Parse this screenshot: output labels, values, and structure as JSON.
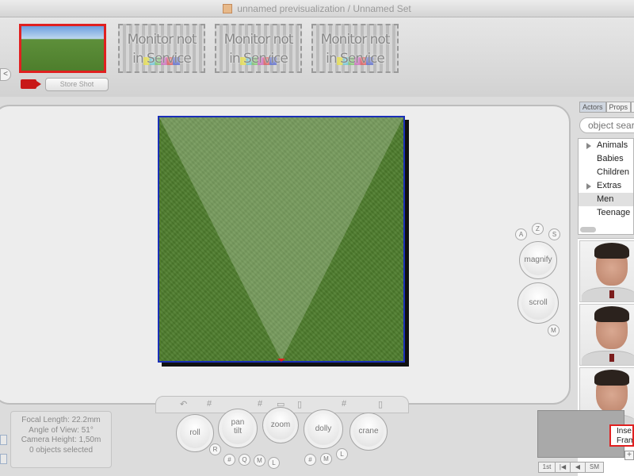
{
  "window": {
    "title": "unnamed previsualization / Unnamed Set"
  },
  "shots": {
    "placeholder_lines": [
      "Monitor not",
      "in Service"
    ],
    "store_shot_label": "Store Shot",
    "nav_back_label": "<"
  },
  "controls": {
    "magnify_label": "magnify",
    "scroll_label": "scroll",
    "roll_label": "roll",
    "pan_tilt_lines": [
      "pan",
      "tilt"
    ],
    "zoom_label": "zoom",
    "dolly_label": "dolly",
    "crane_label": "crane",
    "key_a": "A",
    "key_z": "Z",
    "key_s": "S",
    "key_m": "M",
    "key_r": "R",
    "key_hash": "#",
    "key_q": "Q",
    "key_l": "L",
    "bar_hash": "#"
  },
  "info": {
    "focal_length": "Focal Length: 22.2mm",
    "angle_of_view": "Angle of View: 51°",
    "camera_height": "Camera Height: 1,50m",
    "selection": "0 objects selected"
  },
  "library": {
    "tabs": [
      "Actors",
      "Props",
      "L"
    ],
    "search_placeholder": "object search",
    "categories": [
      {
        "label": "Animals",
        "expandable": true
      },
      {
        "label": "Babies",
        "expandable": false
      },
      {
        "label": "Children",
        "expandable": false
      },
      {
        "label": "Extras",
        "expandable": true
      },
      {
        "label": "Men",
        "expandable": false,
        "selected": true
      },
      {
        "label": "Teenage",
        "expandable": false
      }
    ]
  },
  "inset": {
    "label_lines": [
      "Inse",
      "Fram"
    ],
    "toolbar": [
      "1st",
      "|◀",
      "◀",
      "SM"
    ],
    "plus": "+"
  },
  "colors": {
    "selection_red": "#e02020",
    "viewport_border": "#1a2fb8",
    "grass": "#4e7d2d"
  }
}
